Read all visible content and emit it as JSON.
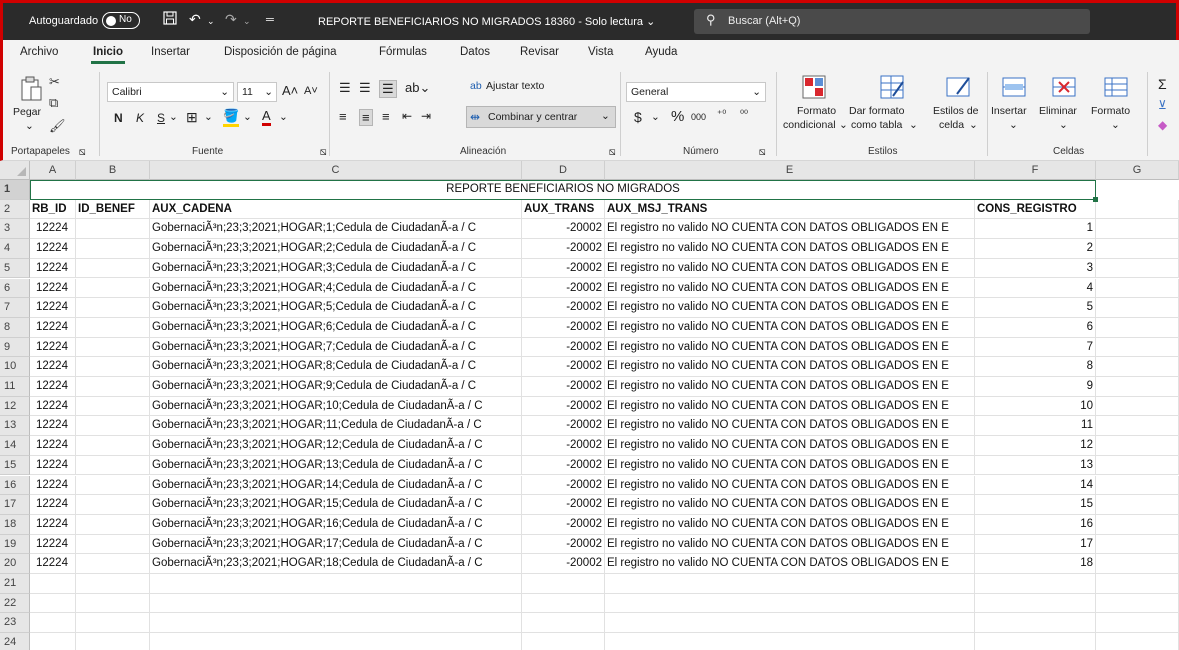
{
  "titlebar": {
    "autosave_label": "Autoguardado",
    "autosave_state": "No",
    "title": "REPORTE BENEFICIARIOS NO MIGRADOS 18360  -  Solo lectura",
    "search_placeholder": "Buscar (Alt+Q)"
  },
  "tabs": [
    "Archivo",
    "Inicio",
    "Insertar",
    "Disposición de página",
    "Fórmulas",
    "Datos",
    "Revisar",
    "Vista",
    "Ayuda"
  ],
  "ribbon": {
    "clipboard": {
      "paste": "Pegar",
      "group": "Portapapeles"
    },
    "font": {
      "name": "Calibri",
      "size": "11",
      "group": "Fuente",
      "bold": "N",
      "italic": "K",
      "underline": "S"
    },
    "alignment": {
      "wrap": "Ajustar texto",
      "merge": "Combinar y centrar",
      "group": "Alineación"
    },
    "number": {
      "format": "General",
      "currency": "$",
      "percent": "%",
      "thousands": "000",
      "group": "Número"
    },
    "styles": {
      "cond_l1": "Formato",
      "cond_l2": "condicional",
      "table_l1": "Dar formato",
      "table_l2": "como tabla",
      "cell_l1": "Estilos de",
      "cell_l2": "celda",
      "group": "Estilos"
    },
    "cells": {
      "insert": "Insertar",
      "delete": "Eliminar",
      "format": "Formato",
      "group": "Celdas"
    }
  },
  "sheet": {
    "columns": [
      "A",
      "B",
      "C",
      "D",
      "E",
      "F",
      "G"
    ],
    "title": "REPORTE BENEFICIARIOS NO MIGRADOS",
    "headers": [
      "RB_ID",
      "ID_BENEF",
      "AUX_CADENA",
      "AUX_TRANS",
      "AUX_MSJ_TRANS",
      "CONS_REGISTRO"
    ],
    "rows": [
      [
        "12224",
        "",
        "GobernaciÃ³n;23;3;2021;HOGAR;1;Cedula de CiudadanÃ-a / C",
        "-20002",
        "El registro no valido NO CUENTA CON DATOS OBLIGADOS EN E",
        "1"
      ],
      [
        "12224",
        "",
        "GobernaciÃ³n;23;3;2021;HOGAR;2;Cedula de CiudadanÃ-a / C",
        "-20002",
        "El registro no valido NO CUENTA CON DATOS OBLIGADOS EN E",
        "2"
      ],
      [
        "12224",
        "",
        "GobernaciÃ³n;23;3;2021;HOGAR;3;Cedula de CiudadanÃ-a / C",
        "-20002",
        "El registro no valido NO CUENTA CON DATOS OBLIGADOS EN E",
        "3"
      ],
      [
        "12224",
        "",
        "GobernaciÃ³n;23;3;2021;HOGAR;4;Cedula de CiudadanÃ-a / C",
        "-20002",
        "El registro no valido NO CUENTA CON DATOS OBLIGADOS EN E",
        "4"
      ],
      [
        "12224",
        "",
        "GobernaciÃ³n;23;3;2021;HOGAR;5;Cedula de CiudadanÃ-a / C",
        "-20002",
        "El registro no valido NO CUENTA CON DATOS OBLIGADOS EN E",
        "5"
      ],
      [
        "12224",
        "",
        "GobernaciÃ³n;23;3;2021;HOGAR;6;Cedula de CiudadanÃ-a / C",
        "-20002",
        "El registro no valido NO CUENTA CON DATOS OBLIGADOS EN E",
        "6"
      ],
      [
        "12224",
        "",
        "GobernaciÃ³n;23;3;2021;HOGAR;7;Cedula de CiudadanÃ-a / C",
        "-20002",
        "El registro no valido NO CUENTA CON DATOS OBLIGADOS EN E",
        "7"
      ],
      [
        "12224",
        "",
        "GobernaciÃ³n;23;3;2021;HOGAR;8;Cedula de CiudadanÃ-a / C",
        "-20002",
        "El registro no valido NO CUENTA CON DATOS OBLIGADOS EN E",
        "8"
      ],
      [
        "12224",
        "",
        "GobernaciÃ³n;23;3;2021;HOGAR;9;Cedula de CiudadanÃ-a / C",
        "-20002",
        "El registro no valido NO CUENTA CON DATOS OBLIGADOS EN E",
        "9"
      ],
      [
        "12224",
        "",
        "GobernaciÃ³n;23;3;2021;HOGAR;10;Cedula de CiudadanÃ-a / C",
        "-20002",
        "El registro no valido NO CUENTA CON DATOS OBLIGADOS EN E",
        "10"
      ],
      [
        "12224",
        "",
        "GobernaciÃ³n;23;3;2021;HOGAR;11;Cedula de CiudadanÃ-a / C",
        "-20002",
        "El registro no valido NO CUENTA CON DATOS OBLIGADOS EN E",
        "11"
      ],
      [
        "12224",
        "",
        "GobernaciÃ³n;23;3;2021;HOGAR;12;Cedula de CiudadanÃ-a / C",
        "-20002",
        "El registro no valido NO CUENTA CON DATOS OBLIGADOS EN E",
        "12"
      ],
      [
        "12224",
        "",
        "GobernaciÃ³n;23;3;2021;HOGAR;13;Cedula de CiudadanÃ-a / C",
        "-20002",
        "El registro no valido NO CUENTA CON DATOS OBLIGADOS EN E",
        "13"
      ],
      [
        "12224",
        "",
        "GobernaciÃ³n;23;3;2021;HOGAR;14;Cedula de CiudadanÃ-a / C",
        "-20002",
        "El registro no valido NO CUENTA CON DATOS OBLIGADOS EN E",
        "14"
      ],
      [
        "12224",
        "",
        "GobernaciÃ³n;23;3;2021;HOGAR;15;Cedula de CiudadanÃ-a / C",
        "-20002",
        "El registro no valido NO CUENTA CON DATOS OBLIGADOS EN E",
        "15"
      ],
      [
        "12224",
        "",
        "GobernaciÃ³n;23;3;2021;HOGAR;16;Cedula de CiudadanÃ-a / C",
        "-20002",
        "El registro no valido NO CUENTA CON DATOS OBLIGADOS EN E",
        "16"
      ],
      [
        "12224",
        "",
        "GobernaciÃ³n;23;3;2021;HOGAR;17;Cedula de CiudadanÃ-a / C",
        "-20002",
        "El registro no valido NO CUENTA CON DATOS OBLIGADOS EN E",
        "17"
      ],
      [
        "12224",
        "",
        "GobernaciÃ³n;23;3;2021;HOGAR;18;Cedula de CiudadanÃ-a / C",
        "-20002",
        "El registro no valido NO CUENTA CON DATOS OBLIGADOS EN E",
        "18"
      ]
    ],
    "row_numbers": [
      "1",
      "2",
      "3",
      "4",
      "5",
      "6",
      "7",
      "8",
      "9",
      "10",
      "11",
      "12",
      "13",
      "14",
      "15",
      "16",
      "17",
      "18",
      "19",
      "20",
      "21",
      "22",
      "23",
      "24"
    ]
  },
  "colors": {
    "accent": "#217346",
    "titlebar": "#2b2b2b",
    "frame": "#d00000"
  }
}
